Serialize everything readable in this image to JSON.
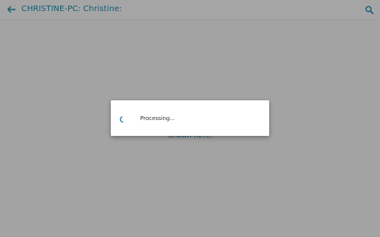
{
  "toolbar": {
    "title": "CHRISTINE-PC: Christine:",
    "back_icon": "arrow-left-icon",
    "search_icon": "search-icon"
  },
  "content": {
    "empty_text": "Shown here."
  },
  "dialog": {
    "message": "Processing...",
    "spinner_icon": "loading-spinner-icon"
  },
  "colors": {
    "accent": "#1e88a8",
    "background": "#f3f3f3",
    "dialog_bg": "#ffffff"
  }
}
